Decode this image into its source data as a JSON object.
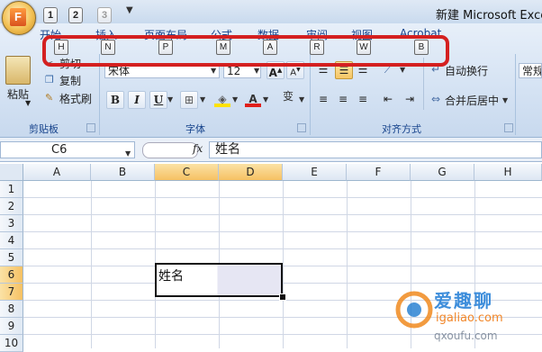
{
  "window": {
    "title": "新建 Microsoft Excel"
  },
  "quick_access": {
    "office_logo": "F",
    "keytips": [
      "1",
      "2",
      "3"
    ]
  },
  "ribbon": {
    "tabs": [
      "开始",
      "插入",
      "页面布局",
      "公式",
      "数据",
      "审阅",
      "视图",
      "Acrobat"
    ],
    "tab_keytips": [
      "H",
      "N",
      "P",
      "M",
      "A",
      "R",
      "W",
      "B"
    ],
    "groups": {
      "clipboard": {
        "label": "剪贴板",
        "paste": "粘贴",
        "cut": "剪切",
        "copy": "复制",
        "format_painter": "格式刷"
      },
      "font": {
        "label": "字体",
        "font_name": "宋体",
        "font_size": "12",
        "bold": "B",
        "italic": "I",
        "underline": "U",
        "wen": "变"
      },
      "alignment": {
        "label": "对齐方式",
        "wrap_text": "自动换行",
        "merge_center": "合并后居中"
      },
      "number": {
        "format": "常规"
      }
    }
  },
  "formula_bar": {
    "name_box": "C6",
    "fx": "fx",
    "value": "姓名"
  },
  "sheet": {
    "columns": [
      "A",
      "B",
      "C",
      "D",
      "E",
      "F",
      "G",
      "H"
    ],
    "rows": [
      "1",
      "2",
      "3",
      "4",
      "5",
      "6",
      "7",
      "8",
      "9",
      "10"
    ],
    "selected_cell": "C6",
    "cell_c6": "姓名"
  },
  "watermark": {
    "line1": "爱趣聊",
    "line2": "igaliao.com",
    "line3": "qxoufu.com"
  },
  "colors": {
    "selection_orange": "#f6c163",
    "ribbon_blue": "#d4e2f3",
    "keytip_box_red": "#d42020"
  }
}
